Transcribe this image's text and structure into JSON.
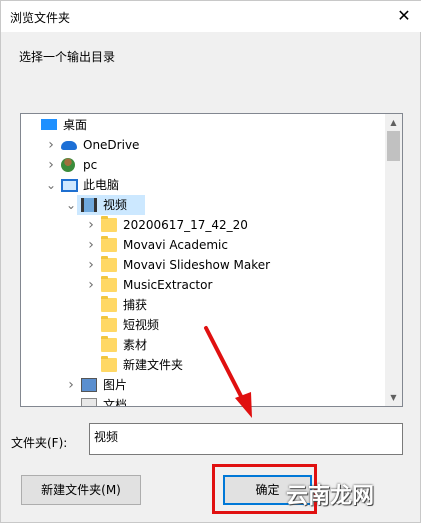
{
  "window": {
    "title": "浏览文件夹",
    "close_glyph": "✕"
  },
  "instruction": "选择一个输出目录",
  "tree": [
    {
      "label": "桌面",
      "icon": "desktop-icon",
      "level": 0,
      "chevron": "",
      "selected": false
    },
    {
      "label": "OneDrive",
      "icon": "onedrive-icon",
      "level": 1,
      "chevron": ">",
      "selected": false
    },
    {
      "label": "pc",
      "icon": "user-icon",
      "level": 1,
      "chevron": ">",
      "selected": false
    },
    {
      "label": "此电脑",
      "icon": "computer-icon",
      "level": 1,
      "chevron": "v",
      "selected": false
    },
    {
      "label": "视频",
      "icon": "video-folder-icon",
      "level": 2,
      "chevron": "v",
      "selected": true
    },
    {
      "label": "20200617_17_42_20",
      "icon": "folder-icon",
      "level": 3,
      "chevron": ">",
      "selected": false
    },
    {
      "label": "Movavi Academic",
      "icon": "folder-icon",
      "level": 3,
      "chevron": ">",
      "selected": false
    },
    {
      "label": "Movavi Slideshow Maker",
      "icon": "folder-icon",
      "level": 3,
      "chevron": ">",
      "selected": false
    },
    {
      "label": "MusicExtractor",
      "icon": "folder-icon",
      "level": 3,
      "chevron": ">",
      "selected": false
    },
    {
      "label": "捕获",
      "icon": "folder-icon",
      "level": 3,
      "chevron": "",
      "selected": false
    },
    {
      "label": "短视频",
      "icon": "folder-icon",
      "level": 3,
      "chevron": "",
      "selected": false
    },
    {
      "label": "素材",
      "icon": "folder-icon",
      "level": 3,
      "chevron": "",
      "selected": false
    },
    {
      "label": "新建文件夹",
      "icon": "folder-icon",
      "level": 3,
      "chevron": "",
      "selected": false
    },
    {
      "label": "图片",
      "icon": "pictures-folder-icon",
      "level": 2,
      "chevron": ">",
      "selected": false
    },
    {
      "label": "文档",
      "icon": "documents-folder-icon",
      "level": 2,
      "chevron": "v",
      "selected": false
    }
  ],
  "folder_field": {
    "label": "文件夹(F):",
    "value": "视频"
  },
  "buttons": {
    "new_folder": "新建文件夹(M)",
    "ok": "确定"
  },
  "watermark": "云南龙网",
  "colors": {
    "selection": "#cce8ff",
    "annotation": "#e01010",
    "focus": "#0078d7"
  }
}
